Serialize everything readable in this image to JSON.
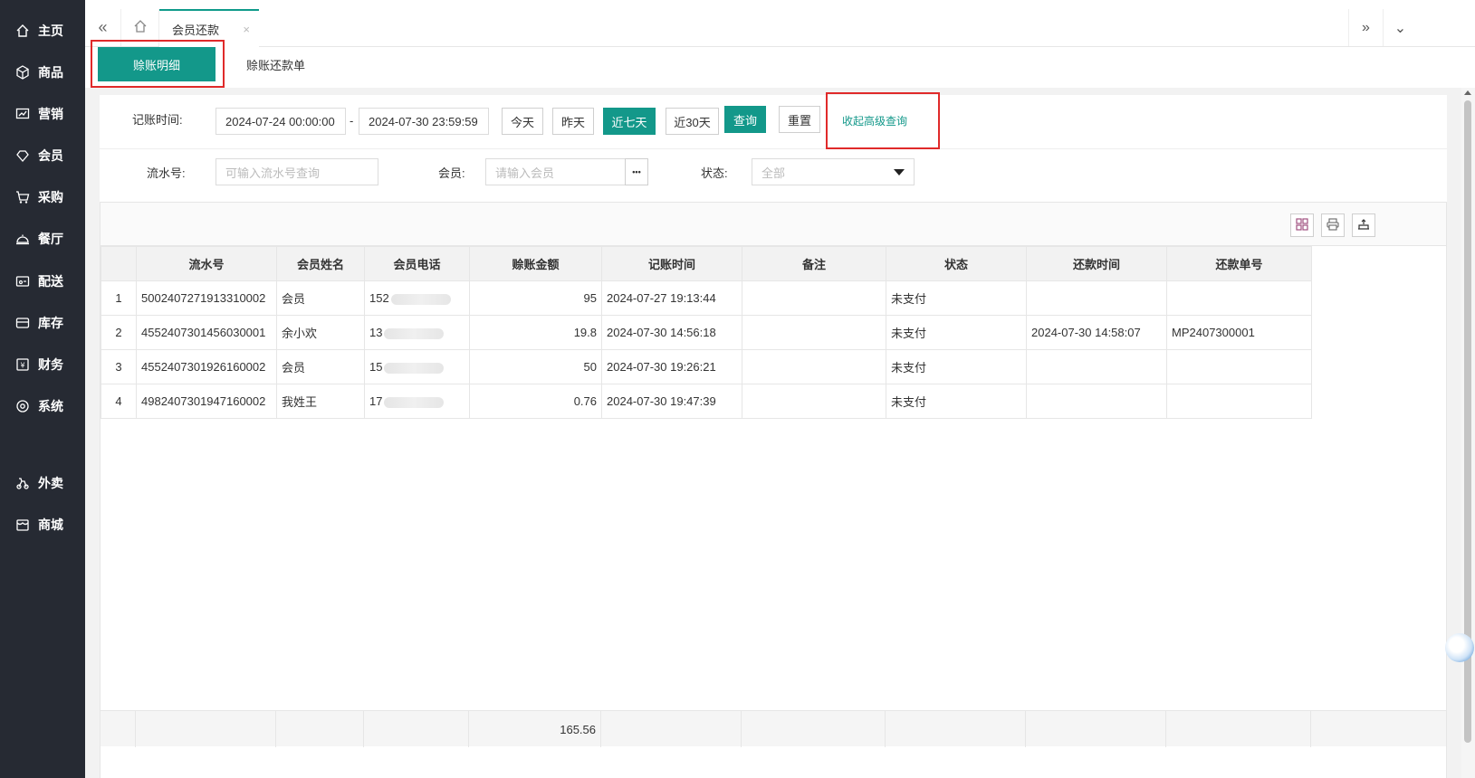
{
  "sidebar": {
    "items": [
      {
        "label": "主页",
        "icon": "home-icon"
      },
      {
        "label": "商品",
        "icon": "box-icon"
      },
      {
        "label": "营销",
        "icon": "chart-icon"
      },
      {
        "label": "会员",
        "icon": "diamond-icon"
      },
      {
        "label": "采购",
        "icon": "cart-icon"
      },
      {
        "label": "餐厅",
        "icon": "cloche-icon"
      },
      {
        "label": "配送",
        "icon": "delivery-icon"
      },
      {
        "label": "库存",
        "icon": "inventory-icon"
      },
      {
        "label": "财务",
        "icon": "finance-icon"
      },
      {
        "label": "系统",
        "icon": "settings-icon"
      },
      {
        "label": "外卖",
        "icon": "takeout-icon"
      },
      {
        "label": "商城",
        "icon": "store-icon"
      }
    ]
  },
  "topbar": {
    "collapse_icon": "«",
    "page_tab": "会员还款",
    "close_icon": "×",
    "next_icon": "»",
    "dropdown_icon": "⌄"
  },
  "subtabs": {
    "active": "赊账明细",
    "second": "赊账还款单"
  },
  "filters": {
    "date_label": "记账时间:",
    "date_start": "2024-07-24 00:00:00",
    "date_sep": "-",
    "date_end": "2024-07-30 23:59:59",
    "btn_today": "今天",
    "btn_yesterday": "昨天",
    "btn_7days": "近七天",
    "btn_30days": "近30天",
    "btn_query": "查询",
    "btn_reset": "重置",
    "advanced_link": "收起高级查询",
    "serial_label": "流水号:",
    "serial_placeholder": "可输入流水号查询",
    "member_label": "会员:",
    "member_placeholder": "请输入会员",
    "member_more": "•••",
    "status_label": "状态:",
    "status_value": "全部"
  },
  "table": {
    "headers": [
      "",
      "流水号",
      "会员姓名",
      "会员电话",
      "赊账金额",
      "记账时间",
      "备注",
      "状态",
      "还款时间",
      "还款单号"
    ],
    "rows": [
      {
        "idx": "1",
        "serial": "5002407271913310002",
        "name": "会员",
        "phone": "152",
        "amount": "95",
        "time": "2024-07-27 19:13:44",
        "note": "",
        "status": "未支付",
        "repay_time": "",
        "repay_no": ""
      },
      {
        "idx": "2",
        "serial": "4552407301456030001",
        "name": "余小欢",
        "phone": "13",
        "amount": "19.8",
        "time": "2024-07-30 14:56:18",
        "note": "",
        "status": "未支付",
        "repay_time": "2024-07-30 14:58:07",
        "repay_no": "MP2407300001"
      },
      {
        "idx": "3",
        "serial": "4552407301926160002",
        "name": "会员",
        "phone": "15",
        "amount": "50",
        "time": "2024-07-30 19:26:21",
        "note": "",
        "status": "未支付",
        "repay_time": "",
        "repay_no": ""
      },
      {
        "idx": "4",
        "serial": "4982407301947160002",
        "name": "我姓王",
        "phone": "17",
        "amount": "0.76",
        "time": "2024-07-30 19:47:39",
        "note": "",
        "status": "未支付",
        "repay_time": "",
        "repay_no": ""
      }
    ],
    "total_amount": "165.56"
  },
  "colors": {
    "accent": "#13988a",
    "sidebar_bg": "#262a33",
    "highlight_red": "#e02a2a"
  }
}
